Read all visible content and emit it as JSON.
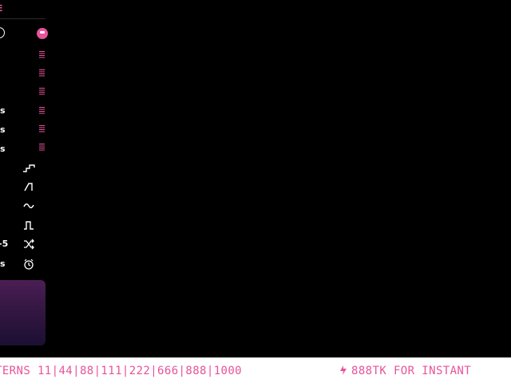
{
  "brand": {
    "logo_text": "E"
  },
  "colors": {
    "accent": "#e8539a",
    "background": "#000000",
    "ticker_bg": "#ffffff"
  },
  "sidebar": {
    "speed_labels": [
      "s",
      "s",
      "s"
    ],
    "range_label": "-5",
    "timer_label": "s",
    "icons": [
      "stairs-up-icon",
      "ramp-icon",
      "sine-wave-icon",
      "square-wave-icon",
      "shuffle-icon",
      "alarm-clock-icon"
    ]
  },
  "ticker": {
    "left_text": "TERNS 11|44|88|111|222|666|888|1000",
    "right_text": "888TK FOR INSTANT"
  }
}
